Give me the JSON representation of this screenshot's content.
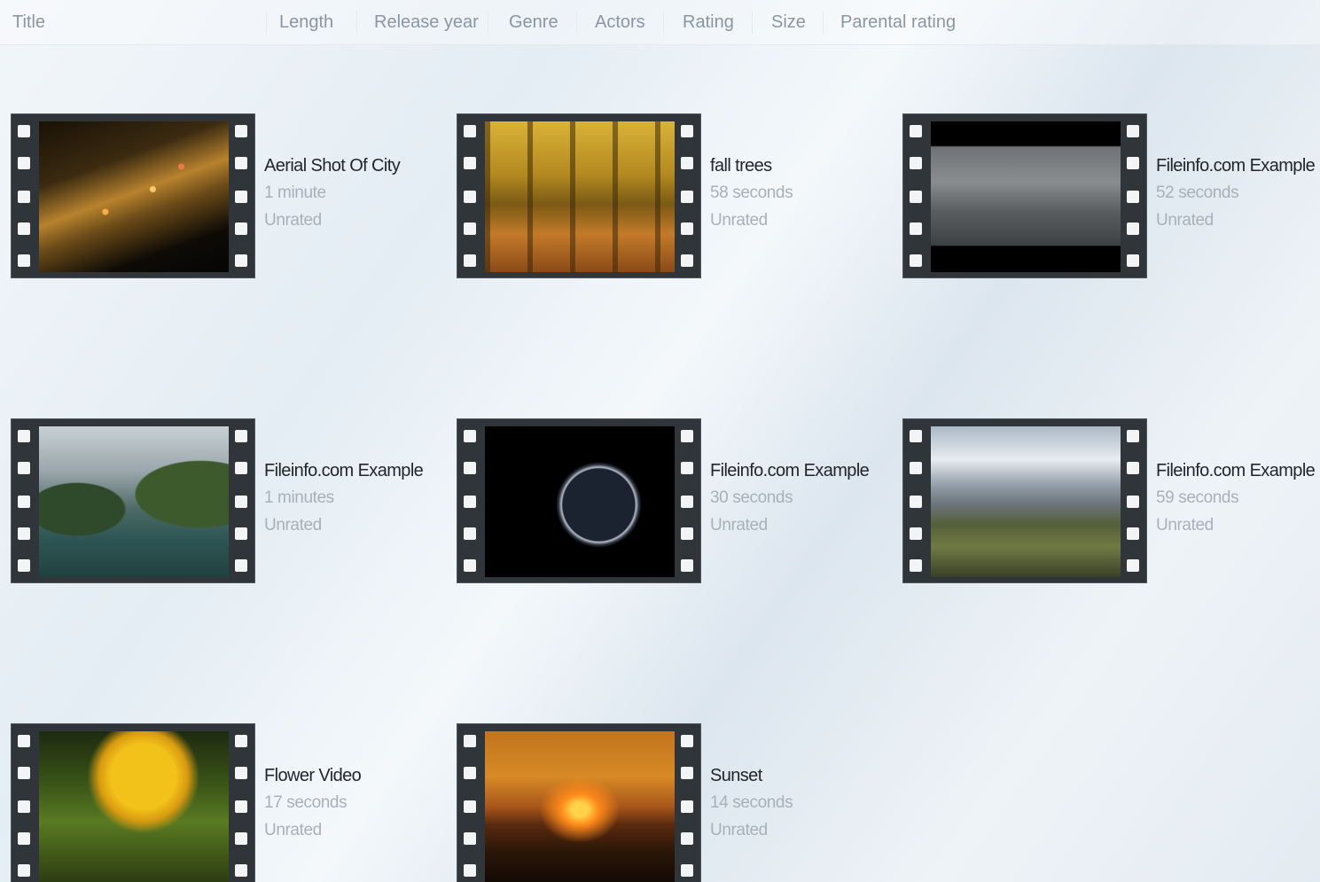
{
  "columns": {
    "title": "Title",
    "length": "Length",
    "release_year": "Release year",
    "genre": "Genre",
    "actors": "Actors",
    "rating": "Rating",
    "size": "Size",
    "parental_rating": "Parental rating"
  },
  "videos": [
    {
      "title": "Aerial Shot Of City",
      "length": "1 minute",
      "rating": "Unrated",
      "thumbnail": "city-night-lights"
    },
    {
      "title": "fall trees",
      "length": "58 seconds",
      "rating": "Unrated",
      "thumbnail": "autumn-forest"
    },
    {
      "title": "Fileinfo.com Example",
      "length": "52 seconds",
      "rating": "Unrated",
      "thumbnail": "grey-landscape"
    },
    {
      "title": "Fileinfo.com Example",
      "length": "1 minutes",
      "rating": "Unrated",
      "thumbnail": "fjord-cliffs"
    },
    {
      "title": "Fileinfo.com Example",
      "length": "30 seconds",
      "rating": "Unrated",
      "thumbnail": "planet-in-space"
    },
    {
      "title": "Fileinfo.com Example",
      "length": "59 seconds",
      "rating": "Unrated",
      "thumbnail": "snowy-mountains"
    },
    {
      "title": "Flower Video",
      "length": "17 seconds",
      "rating": "Unrated",
      "thumbnail": "yellow-flower"
    },
    {
      "title": "Sunset",
      "length": "14 seconds",
      "rating": "Unrated",
      "thumbnail": "sunset-horizon"
    }
  ]
}
